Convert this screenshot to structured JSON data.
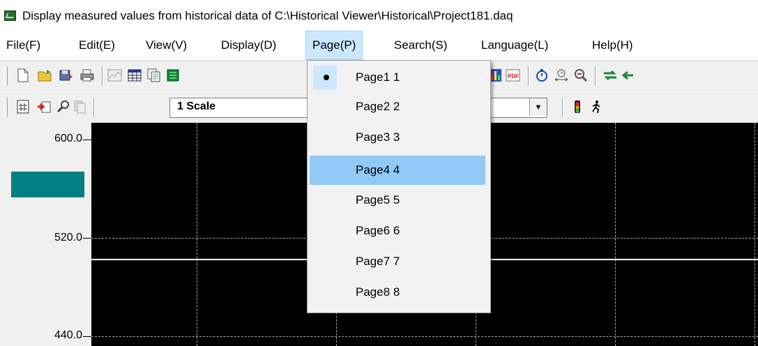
{
  "window": {
    "title": "Display measured values from historical data of C:\\Historical Viewer\\Historical\\Project181.daq",
    "icon": "chart-window-icon"
  },
  "menubar": {
    "items": [
      {
        "label": "File(F)"
      },
      {
        "label": "Edit(E)"
      },
      {
        "label": "View(V)"
      },
      {
        "label": "Display(D)"
      },
      {
        "label": "Page(P)"
      },
      {
        "label": "Search(S)"
      },
      {
        "label": "Language(L)"
      },
      {
        "label": "Help(H)"
      }
    ],
    "active_menu": "Page(P)"
  },
  "toolbar": {
    "scale_select": "1 Scale"
  },
  "page_menu": {
    "items": [
      {
        "label": "Page1 1",
        "checked": true
      },
      {
        "label": "Page2 2"
      },
      {
        "label": "Page3 3"
      },
      {
        "label": "Page4 4",
        "highlighted": true
      },
      {
        "label": "Page5 5"
      },
      {
        "label": "Page6 6"
      },
      {
        "label": "Page7 7"
      },
      {
        "label": "Page8 8"
      }
    ]
  },
  "chart": {
    "y_ticks": [
      "600.0",
      "520.0",
      "440.0"
    ],
    "colors": {
      "background": "#000000",
      "trace": "#ffffff",
      "scale_bar": "#008080",
      "grid": "#aaaaaa"
    }
  }
}
